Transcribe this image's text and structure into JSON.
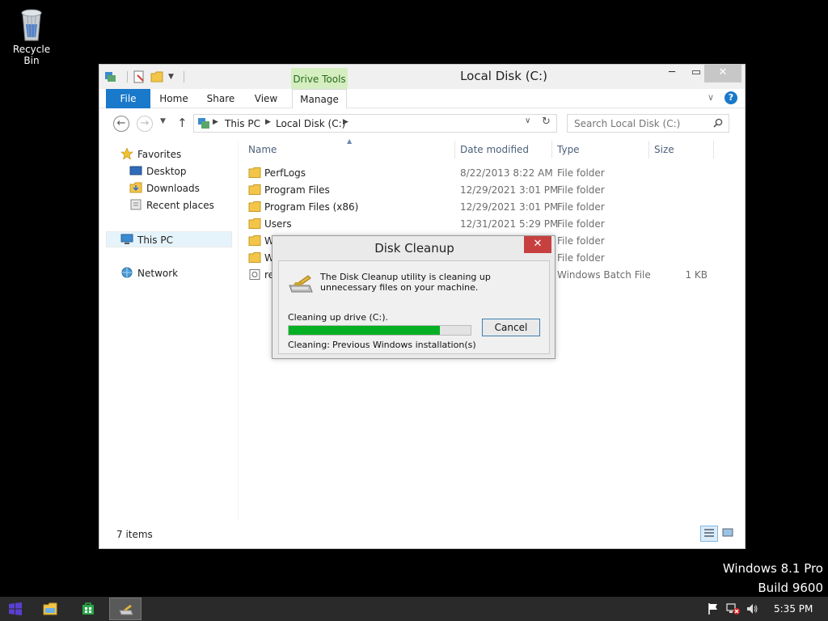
{
  "desktop": {
    "recycle_bin_label": "Recycle Bin",
    "watermark_line1": "Windows 8.1 Pro",
    "watermark_line2": "Build 9600"
  },
  "explorer": {
    "title": "Local Disk (C:)",
    "contextual_tab_group": "Drive Tools",
    "ribbon_tabs": [
      "File",
      "Home",
      "Share",
      "View",
      "Manage"
    ],
    "address_crumbs": [
      "This PC",
      "Local Disk (C:)"
    ],
    "search_placeholder": "Search Local Disk (C:)",
    "nav": {
      "favorites": "Favorites",
      "desktop": "Desktop",
      "downloads": "Downloads",
      "recent": "Recent places",
      "this_pc": "This PC",
      "network": "Network"
    },
    "columns": [
      "Name",
      "Date modified",
      "Type",
      "Size"
    ],
    "files": [
      {
        "name": "PerfLogs",
        "date": "8/22/2013 8:22 AM",
        "type": "File folder",
        "size": ""
      },
      {
        "name": "Program Files",
        "date": "12/29/2021 3:01 PM",
        "type": "File folder",
        "size": ""
      },
      {
        "name": "Program Files (x86)",
        "date": "12/29/2021 3:01 PM",
        "type": "File folder",
        "size": ""
      },
      {
        "name": "Users",
        "date": "12/31/2021 5:29 PM",
        "type": "File folder",
        "size": ""
      },
      {
        "name": "W",
        "date": "",
        "type": "File folder",
        "size": ""
      },
      {
        "name": "W",
        "date": "",
        "type": "File folder",
        "size": ""
      },
      {
        "name": "re",
        "date": "",
        "type": "Windows Batch File",
        "size": "1 KB"
      }
    ],
    "status_count": "7 items"
  },
  "dialog": {
    "title": "Disk Cleanup",
    "message": "The Disk Cleanup utility is cleaning up unnecessary files on your machine.",
    "drive_text": "Cleaning up drive  (C:).",
    "progress_fraction": 0.83,
    "cancel_label": "Cancel",
    "cleaning_label": "Cleaning:",
    "cleaning_value": "Previous Windows installation(s)",
    "progress_color": "#06b025"
  },
  "taskbar": {
    "clock": "5:35 PM",
    "accent": "#5a3fd0"
  },
  "icons": [
    "recycle-bin-icon",
    "folder-icon",
    "pc-icon",
    "star-icon",
    "desktop-icon",
    "downloads-icon",
    "recent-icon",
    "network-icon",
    "batch-file-icon",
    "search-icon",
    "disk-cleanup-icon",
    "windows-start-icon",
    "file-explorer-icon",
    "store-icon",
    "flag-icon",
    "network-error-icon",
    "speaker-icon"
  ]
}
